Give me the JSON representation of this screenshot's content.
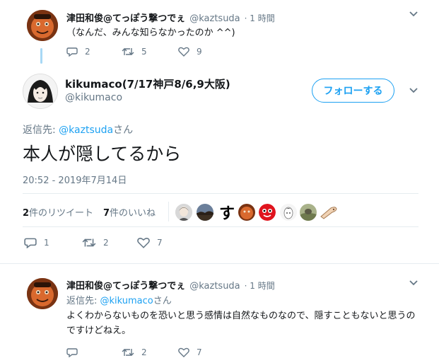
{
  "tweet_top": {
    "display_name": "津田和俊@てっぽう撃つでぇ",
    "handle": "@kaztsuda",
    "time": "· 1 時間",
    "text": "（なんだ、みんな知らなかったのか ^^)",
    "reply_count": "2",
    "retweet_count": "5",
    "like_count": "9"
  },
  "main_tweet": {
    "display_name": "kikumaco(7/17神戸8/6,9大阪)",
    "handle": "@kikumaco",
    "follow_label": "フォローする",
    "reply_prefix": "返信先: ",
    "reply_to": "@kaztsuda",
    "reply_suffix": "さん",
    "text": "本人が隠してるから",
    "timestamp": "20:52 - 2019年7月14日",
    "retweet_stat_num": "2",
    "retweet_stat_label": "件のリツイート",
    "like_stat_num": "7",
    "like_stat_label": "件のいいね",
    "liker_char": "す",
    "reply_count": "1",
    "retweet_count": "2",
    "like_count": "7"
  },
  "tweet_bottom": {
    "display_name": "津田和俊@てっぽう撃つでぇ",
    "handle": "@kaztsuda",
    "time": "· 1 時間",
    "reply_prefix": "返信先: ",
    "reply_to": "@kikumaco",
    "reply_suffix": "さん",
    "text": "よくわからないものを恐いと思う感情は自然なものなので、隠すこともないと思うのですけどねえ。",
    "reply_count": "",
    "retweet_count": "2",
    "like_count": "7"
  },
  "icons": {
    "reply": "reply-icon",
    "retweet": "retweet-icon",
    "like": "heart-icon",
    "more": "chevron-down-icon"
  },
  "colors": {
    "accent": "#1da1f2",
    "muted": "#657786",
    "text": "#14171a",
    "thread_line": "#a8d8f5"
  }
}
